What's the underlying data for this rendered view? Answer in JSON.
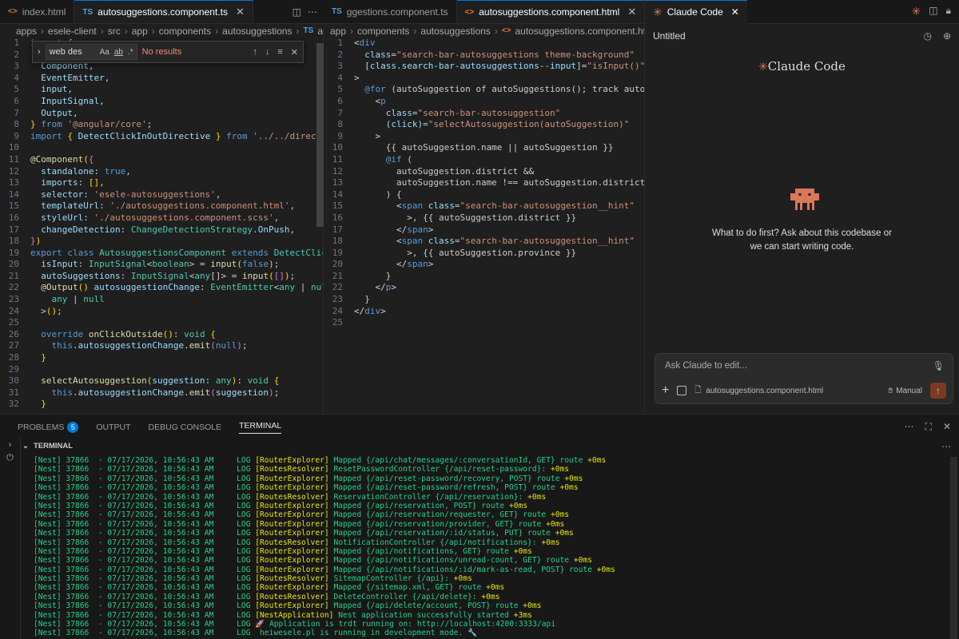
{
  "left_editor": {
    "tabs": [
      {
        "icon": "<>",
        "label": "index.html",
        "active": false
      },
      {
        "icon": "TS",
        "label": "autosuggestions.component.ts",
        "active": true
      }
    ],
    "breadcrumb": [
      "apps",
      "esele-client",
      "src",
      "app",
      "components",
      "autosuggestions",
      "autosu"
    ],
    "breadcrumb_file_icon": "TS",
    "find": {
      "query": "web des",
      "opt_case": "Aa",
      "opt_word": "ab",
      "opt_regex": ".*",
      "status": "No results"
    },
    "lines": [
      {
        "n": "1",
        "h": "<span class='kw'>import</span> <span class='br'>{</span>"
      },
      {
        "n": "2",
        "h": ""
      },
      {
        "n": "3",
        "h": "  <span class='pr'>Component</span>,"
      },
      {
        "n": "4",
        "h": "  <span class='pr'>EventEmitter</span>,"
      },
      {
        "n": "5",
        "h": "  <span class='pr'>input</span>,"
      },
      {
        "n": "6",
        "h": "  <span class='pr'>InputSignal</span>,"
      },
      {
        "n": "7",
        "h": "  <span class='pr'>Output</span>,"
      },
      {
        "n": "8",
        "h": "<span class='br'>}</span> <span class='kw'>from</span> <span class='str'>'@angular/core'</span>;"
      },
      {
        "n": "9",
        "h": "<span class='kw'>import</span> <span class='br'>{</span> <span class='pr'>DetectClickInOutDirective</span> <span class='br'>}</span> <span class='kw'>from</span> <span class='str'>'../../directives</span>"
      },
      {
        "n": "10",
        "h": ""
      },
      {
        "n": "11",
        "h": "<span class='dec'>@Component</span><span class='br'>(</span><span class='br2'>{</span>"
      },
      {
        "n": "12",
        "h": "  <span class='pr'>standalone</span>: <span class='kw'>true</span>,"
      },
      {
        "n": "13",
        "h": "  <span class='pr'>imports</span>: <span class='br'>[]</span>,"
      },
      {
        "n": "14",
        "h": "  <span class='pr'>selector</span>: <span class='str'>'esele-autosuggestions'</span>,"
      },
      {
        "n": "15",
        "h": "  <span class='pr'>templateUrl</span>: <span class='str'>'./autosuggestions.component.html'</span>,"
      },
      {
        "n": "16",
        "h": "  <span class='pr'>styleUrl</span>: <span class='str'>'./autosuggestions.component.scss'</span>,"
      },
      {
        "n": "17",
        "h": "  <span class='pr'>changeDetection</span>: <span class='ty'>ChangeDetectionStrategy</span>.<span class='pr'>OnPush</span>,"
      },
      {
        "n": "18",
        "h": "<span class='br2'>}</span><span class='br'>)</span>"
      },
      {
        "n": "19",
        "h": "<span class='kw'>export</span> <span class='kw'>class</span> <span class='ty'>AutosuggestionsComponent</span> <span class='kw'>extends</span> <span class='ty'>DetectClickIn</span>"
      },
      {
        "n": "20",
        "h": "  <span class='pr'>isInput</span>: <span class='ty'>InputSignal</span>&lt;<span class='ty'>boolean</span>&gt; = <span class='fn'>input</span><span class='br'>(</span><span class='kw'>false</span><span class='br'>)</span>;"
      },
      {
        "n": "21",
        "h": "  <span class='pr'>autoSuggestions</span>: <span class='ty'>InputSignal</span>&lt;<span class='ty'>any</span>[]&gt; = <span class='fn'>input</span><span class='br'>(</span><span class='br2'>[]</span><span class='br'>)</span>;"
      },
      {
        "n": "22",
        "h": "  <span class='dec'>@Output</span><span class='br'>()</span> <span class='pr'>autosuggestionChange</span>: <span class='ty'>EventEmitter</span>&lt;<span class='ty'>any</span> | <span class='ty'>null</span>&gt;"
      },
      {
        "n": "23",
        "h": "    <span class='ty'>any</span> | <span class='ty'>null</span>"
      },
      {
        "n": "24",
        "h": "  &gt;<span class='br'>()</span>;"
      },
      {
        "n": "25",
        "h": ""
      },
      {
        "n": "26",
        "h": "  <span class='kw'>override</span> <span class='fn'>onClickOutside</span><span class='br'>()</span>: <span class='ty'>void</span> <span class='br'>{</span>"
      },
      {
        "n": "27",
        "h": "    <span class='kw'>this</span>.<span class='pr'>autosuggestionChange</span>.<span class='fn'>emit</span><span class='br2'>(</span><span class='kw'>null</span><span class='br2'>)</span>;"
      },
      {
        "n": "28",
        "h": "  <span class='br'>}</span>"
      },
      {
        "n": "29",
        "h": ""
      },
      {
        "n": "30",
        "h": "  <span class='fn'>selectAutosuggestion</span><span class='br'>(</span><span class='pr'>suggestion</span>: <span class='ty'>any</span><span class='br'>)</span>: <span class='ty'>void</span> <span class='br'>{</span>"
      },
      {
        "n": "31",
        "h": "    <span class='kw'>this</span>.<span class='pr'>autosuggestionChange</span>.<span class='fn'>emit</span><span class='br2'>(</span><span class='pr'>suggestion</span><span class='br2'>)</span>;"
      },
      {
        "n": "32",
        "h": "  <span class='br'>}</span>"
      }
    ]
  },
  "right_editor": {
    "tabs": [
      {
        "icon": "TS",
        "label": "ggestions.component.ts",
        "active": false
      },
      {
        "icon": "<>",
        "label": "autosuggestions.component.html",
        "active": true
      }
    ],
    "breadcrumb": [
      "app",
      "components",
      "autosuggestions",
      "autosuggestions.component.html"
    ],
    "breadcrumb_file_icon": "<>",
    "lines": [
      {
        "n": "1",
        "h": "<span class='pu'>&lt;</span><span class='tag'>div</span>"
      },
      {
        "n": "2",
        "h": "  <span class='attr'>class</span>=<span class='str'>\"search-bar-autosuggestions theme-background\"</span>"
      },
      {
        "n": "3",
        "h": "  <span class='attr'>[class.search-bar-autosuggestions--input]</span>=<span class='str'>\"isInput()\"</span>"
      },
      {
        "n": "4",
        "h": "<span class='pu'>&gt;</span>"
      },
      {
        "n": "5",
        "h": "  <span class='kw'>@for</span> (autoSuggestion of autoSuggestions(); track autoSugg"
      },
      {
        "n": "6",
        "h": "    <span class='pu'>&lt;</span><span class='tag'>p</span>"
      },
      {
        "n": "7",
        "h": "      <span class='attr'>class</span>=<span class='str'>\"search-bar-autosuggestion\"</span>"
      },
      {
        "n": "8",
        "h": "      <span class='attr'>(click)</span>=<span class='str'>\"selectAutosuggestion(autoSuggestion)\"</span>"
      },
      {
        "n": "9",
        "h": "    <span class='pu'>&gt;</span>"
      },
      {
        "n": "10",
        "h": "      {{ autoSuggestion.name || autoSuggestion }}"
      },
      {
        "n": "11",
        "h": "      <span class='kw'>@if</span> ("
      },
      {
        "n": "12",
        "h": "        autoSuggestion.district &amp;&amp;"
      },
      {
        "n": "13",
        "h": "        autoSuggestion.name !== autoSuggestion.district"
      },
      {
        "n": "14",
        "h": "      ) {"
      },
      {
        "n": "15",
        "h": "        <span class='pu'>&lt;</span><span class='tag'>span</span> <span class='attr'>class</span>=<span class='str'>\"search-bar-autosuggestion__hint\"</span>"
      },
      {
        "n": "16",
        "h": "          <span class='pu'>&gt;</span>, {{ autoSuggestion.district }}"
      },
      {
        "n": "17",
        "h": "        <span class='pu'>&lt;/</span><span class='tag'>span</span><span class='pu'>&gt;</span>"
      },
      {
        "n": "18",
        "h": "        <span class='pu'>&lt;</span><span class='tag'>span</span> <span class='attr'>class</span>=<span class='str'>\"search-bar-autosuggestion__hint\"</span>"
      },
      {
        "n": "19",
        "h": "          <span class='pu'>&gt;</span>, {{ autoSuggestion.province }}"
      },
      {
        "n": "20",
        "h": "        <span class='pu'>&lt;/</span><span class='tag'>span</span><span class='pu'>&gt;</span>"
      },
      {
        "n": "21",
        "h": "      }"
      },
      {
        "n": "22",
        "h": "    <span class='pu'>&lt;/</span><span class='tag'>p</span><span class='pu'>&gt;</span>"
      },
      {
        "n": "23",
        "h": "  }"
      },
      {
        "n": "24",
        "h": "<span class='pu'>&lt;/</span><span class='tag'>div</span><span class='pu'>&gt;</span>"
      },
      {
        "n": "25",
        "h": ""
      }
    ]
  },
  "claude_panel": {
    "tab_label": "Claude Code",
    "session_title": "Untitled",
    "brand": "Claude Code",
    "welcome_line1": "What to do first? Ask about this codebase or",
    "welcome_line2": "we can start writing code.",
    "input_placeholder": "Ask Claude to edit...",
    "attached_file": "autosuggestions.component.html",
    "mode_label": "Manual",
    "accent_color": "#d97757"
  },
  "bottom_panel": {
    "tabs": [
      {
        "label": "PROBLEMS",
        "badge": "5",
        "active": false
      },
      {
        "label": "OUTPUT",
        "active": false
      },
      {
        "label": "DEBUG CONSOLE",
        "active": false
      },
      {
        "label": "TERMINAL",
        "active": true
      }
    ],
    "terminal_header": "TERMINAL",
    "log_lines": [
      {
        "pid": "37866",
        "date": "07/17/2026, 10:56:43 AM",
        "ctx": "[RouterExplorer]",
        "msg": "Mapped {/api/chat/messages/:conversationId, GET} route",
        "t": "+0ms"
      },
      {
        "pid": "37866",
        "date": "07/17/2026, 10:56:43 AM",
        "ctx": "[RoutesResolver]",
        "msg": "ResetPasswordController {/api/reset-password}:",
        "t": "+0ms"
      },
      {
        "pid": "37866",
        "date": "07/17/2026, 10:56:43 AM",
        "ctx": "[RouterExplorer]",
        "msg": "Mapped {/api/reset-password/recovery, POST} route",
        "t": "+0ms"
      },
      {
        "pid": "37866",
        "date": "07/17/2026, 10:56:43 AM",
        "ctx": "[RouterExplorer]",
        "msg": "Mapped {/api/reset-password/refresh, POST} route",
        "t": "+0ms"
      },
      {
        "pid": "37866",
        "date": "07/17/2026, 10:56:43 AM",
        "ctx": "[RoutesResolver]",
        "msg": "ReservationController {/api/reservation}:",
        "t": "+0ms"
      },
      {
        "pid": "37866",
        "date": "07/17/2026, 10:56:43 AM",
        "ctx": "[RouterExplorer]",
        "msg": "Mapped {/api/reservation, POST} route",
        "t": "+0ms"
      },
      {
        "pid": "37866",
        "date": "07/17/2026, 10:56:43 AM",
        "ctx": "[RouterExplorer]",
        "msg": "Mapped {/api/reservation/requester, GET} route",
        "t": "+0ms"
      },
      {
        "pid": "37866",
        "date": "07/17/2026, 10:56:43 AM",
        "ctx": "[RouterExplorer]",
        "msg": "Mapped {/api/reservation/provider, GET} route",
        "t": "+0ms"
      },
      {
        "pid": "37866",
        "date": "07/17/2026, 10:56:43 AM",
        "ctx": "[RouterExplorer]",
        "msg": "Mapped {/api/reservation/:id/status, PUT} route",
        "t": "+0ms"
      },
      {
        "pid": "37866",
        "date": "07/17/2026, 10:56:43 AM",
        "ctx": "[RoutesResolver]",
        "msg": "NotificationController {/api/notifications}:",
        "t": "+0ms"
      },
      {
        "pid": "37866",
        "date": "07/17/2026, 10:56:43 AM",
        "ctx": "[RouterExplorer]",
        "msg": "Mapped {/api/notifications, GET} route",
        "t": "+0ms"
      },
      {
        "pid": "37866",
        "date": "07/17/2026, 10:56:43 AM",
        "ctx": "[RouterExplorer]",
        "msg": "Mapped {/api/notifications/unread-count, GET} route",
        "t": "+0ms"
      },
      {
        "pid": "37866",
        "date": "07/17/2026, 10:56:43 AM",
        "ctx": "[RouterExplorer]",
        "msg": "Mapped {/api/notifications/:id/mark-as-read, POST} route",
        "t": "+0ms"
      },
      {
        "pid": "37866",
        "date": "07/17/2026, 10:56:43 AM",
        "ctx": "[RoutesResolver]",
        "msg": "SitemapController {/api}:",
        "t": "+0ms"
      },
      {
        "pid": "37866",
        "date": "07/17/2026, 10:56:43 AM",
        "ctx": "[RouterExplorer]",
        "msg": "Mapped {/sitemap.xml, GET} route",
        "t": "+0ms"
      },
      {
        "pid": "37866",
        "date": "07/17/2026, 10:56:43 AM",
        "ctx": "[RoutesResolver]",
        "msg": "DeleteController {/api/delete}:",
        "t": "+0ms"
      },
      {
        "pid": "37866",
        "date": "07/17/2026, 10:56:43 AM",
        "ctx": "[RouterExplorer]",
        "msg": "Mapped {/api/delete/account, POST} route",
        "t": "+0ms"
      },
      {
        "pid": "37866",
        "date": "07/17/2026, 10:56:43 AM",
        "ctx": "[NestApplication]",
        "msg": "Nest application successfully started",
        "t": "+3ms"
      },
      {
        "pid": "37866",
        "date": "07/17/2026, 10:56:43 AM",
        "ctx": "🚀",
        "msg": "Application is trdt running on: http://localhost:4200:3333/api",
        "t": ""
      },
      {
        "pid": "37866",
        "date": "07/17/2026, 10:56:43 AM",
        "ctx": "",
        "msg": "heiwesele.pl is running in development mode. 🔧",
        "t": ""
      }
    ]
  }
}
